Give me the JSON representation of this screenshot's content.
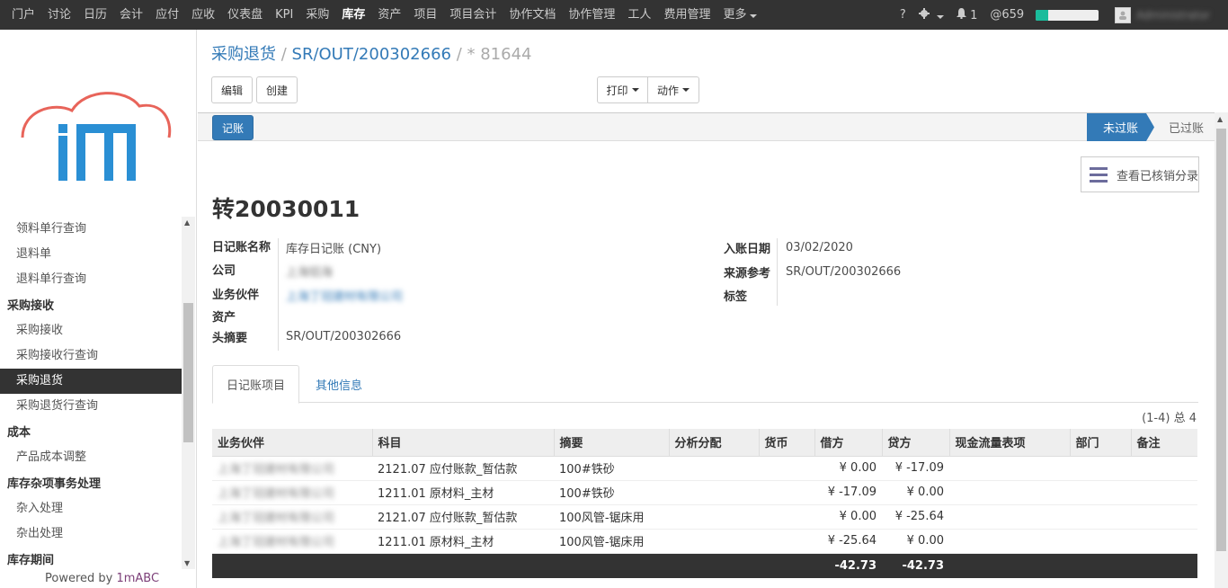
{
  "topnav": {
    "items": [
      "门户",
      "讨论",
      "日历",
      "会计",
      "应付",
      "应收",
      "仪表盘",
      "KPI",
      "采购",
      "库存",
      "资产",
      "项目",
      "项目会计",
      "协作文档",
      "协作管理",
      "工人",
      "费用管理",
      "更多"
    ],
    "active_index": 9,
    "help": "?",
    "settings_icon": "gear-icon",
    "notifications": "1",
    "mentions": "@659",
    "progress_fraction": 0.2,
    "username": "Administrator"
  },
  "sidebar": {
    "items": [
      {
        "type": "item",
        "label": "领料单行查询"
      },
      {
        "type": "item",
        "label": "退料单"
      },
      {
        "type": "item",
        "label": "退料单行查询"
      },
      {
        "type": "header",
        "label": "采购接收"
      },
      {
        "type": "item",
        "label": "采购接收"
      },
      {
        "type": "item",
        "label": "采购接收行查询"
      },
      {
        "type": "item",
        "label": "采购退货",
        "selected": true
      },
      {
        "type": "item",
        "label": "采购退货行查询"
      },
      {
        "type": "header",
        "label": "成本"
      },
      {
        "type": "item",
        "label": "产品成本调整"
      },
      {
        "type": "header",
        "label": "库存杂项事务处理"
      },
      {
        "type": "item",
        "label": "杂入处理"
      },
      {
        "type": "item",
        "label": "杂出处理"
      },
      {
        "type": "header",
        "label": "库存期间"
      }
    ],
    "powered_prefix": "Powered by ",
    "powered_brand": "1mABC"
  },
  "breadcrumb": {
    "b1": "采购退货",
    "sep1": " / ",
    "b2": "SR/OUT/200302666",
    "sep2": " / ",
    "b3": " * 81644"
  },
  "buttons": {
    "edit": "编辑",
    "create": "创建",
    "print": "打印",
    "action": "动作",
    "post": "记账"
  },
  "status": {
    "active": "未过账",
    "done": "已过账"
  },
  "smart_button": {
    "icon": "list-icon",
    "label": "查看已核销分录"
  },
  "record": {
    "title": "转20030011",
    "fields_left": [
      {
        "label": "日记账名称",
        "value": "库存日记账 (CNY)",
        "style": "plain"
      },
      {
        "label": "公司",
        "value": "上海铝海",
        "style": "blur"
      },
      {
        "label": "业务伙伴",
        "value": "上海丁冠建材有限公司",
        "style": "blurlink"
      },
      {
        "label": "资产",
        "value": "",
        "style": "plain"
      },
      {
        "label": "头摘要",
        "value": "SR/OUT/200302666",
        "style": "plain"
      }
    ],
    "fields_right": [
      {
        "label": "入账日期",
        "value": "03/02/2020"
      },
      {
        "label": "来源参考",
        "value": "SR/OUT/200302666"
      },
      {
        "label": "标签",
        "value": ""
      }
    ]
  },
  "tabs": {
    "t1": "日记账项目",
    "t2": "其他信息"
  },
  "pager": "(1-4) 总 4",
  "table": {
    "headers": [
      "业务伙伴",
      "科目",
      "摘要",
      "分析分配",
      "货币",
      "借方",
      "贷方",
      "现金流量表项",
      "部门",
      "备注"
    ],
    "rows": [
      {
        "partner": "上海丁冠建材有限公司",
        "account": "2121.07 应付账款_暂估款",
        "memo": "100#铁砂",
        "analytic": "",
        "currency": "",
        "debit": "¥ 0.00",
        "credit": "¥ -17.09",
        "cashflow": "",
        "dept": "",
        "note": ""
      },
      {
        "partner": "上海丁冠建材有限公司",
        "account": "1211.01 原材料_主材",
        "memo": "100#铁砂",
        "analytic": "",
        "currency": "",
        "debit": "¥ -17.09",
        "credit": "¥ 0.00",
        "cashflow": "",
        "dept": "",
        "note": ""
      },
      {
        "partner": "上海丁冠建材有限公司",
        "account": "2121.07 应付账款_暂估款",
        "memo": "100风管-锯床用",
        "analytic": "",
        "currency": "",
        "debit": "¥ 0.00",
        "credit": "¥ -25.64",
        "cashflow": "",
        "dept": "",
        "note": ""
      },
      {
        "partner": "上海丁冠建材有限公司",
        "account": "1211.01 原材料_主材",
        "memo": "100风管-锯床用",
        "analytic": "",
        "currency": "",
        "debit": "¥ -25.64",
        "credit": "¥ 0.00",
        "cashflow": "",
        "dept": "",
        "note": ""
      }
    ],
    "total_debit": "-42.73",
    "total_credit": "-42.73"
  },
  "colors": {
    "topbar": "#333333",
    "primary": "#337ab7",
    "brand": "#7c3f78",
    "progress": "#1abc9c"
  }
}
